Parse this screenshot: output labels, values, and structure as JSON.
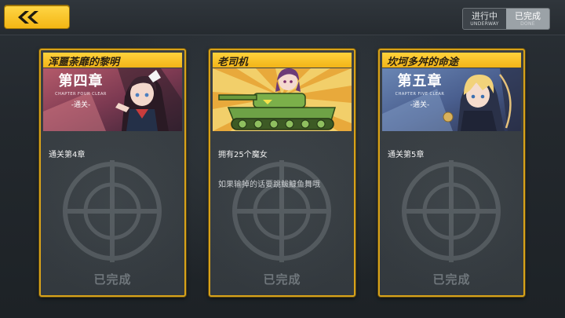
{
  "header": {
    "back_icon": "double-chevron-left-icon",
    "toggle": {
      "underway_cn": "进行中",
      "underway_en": "UNDERWAY",
      "done_cn": "已完成",
      "done_en": "DONE",
      "active": "underway"
    }
  },
  "colors": {
    "accent_yellow": "#f3b614",
    "card_border": "#d8a21a",
    "card_bg": "#363c41"
  },
  "cards": [
    {
      "title": "浑噩荼靡的黎明",
      "art": {
        "chapter_cn": "第四章",
        "chapter_en": "CHAPTER FOUR CLEAR",
        "clear_cn": "-通关-"
      },
      "desc1": "通关第4章",
      "desc2": "",
      "status": "已完成"
    },
    {
      "title": "老司机",
      "art": {
        "type": "tank"
      },
      "desc1": "拥有25个魔女",
      "desc2": "如果输掉的话要跳鲅鱇鱼舞哦",
      "status": "已完成"
    },
    {
      "title": "坎坷多舛的命途",
      "art": {
        "chapter_cn": "第五章",
        "chapter_en": "CHAPTER FIVE CLEAR",
        "clear_cn": "-通关-"
      },
      "desc1": "通关第5章",
      "desc2": "",
      "status": "已完成"
    }
  ]
}
